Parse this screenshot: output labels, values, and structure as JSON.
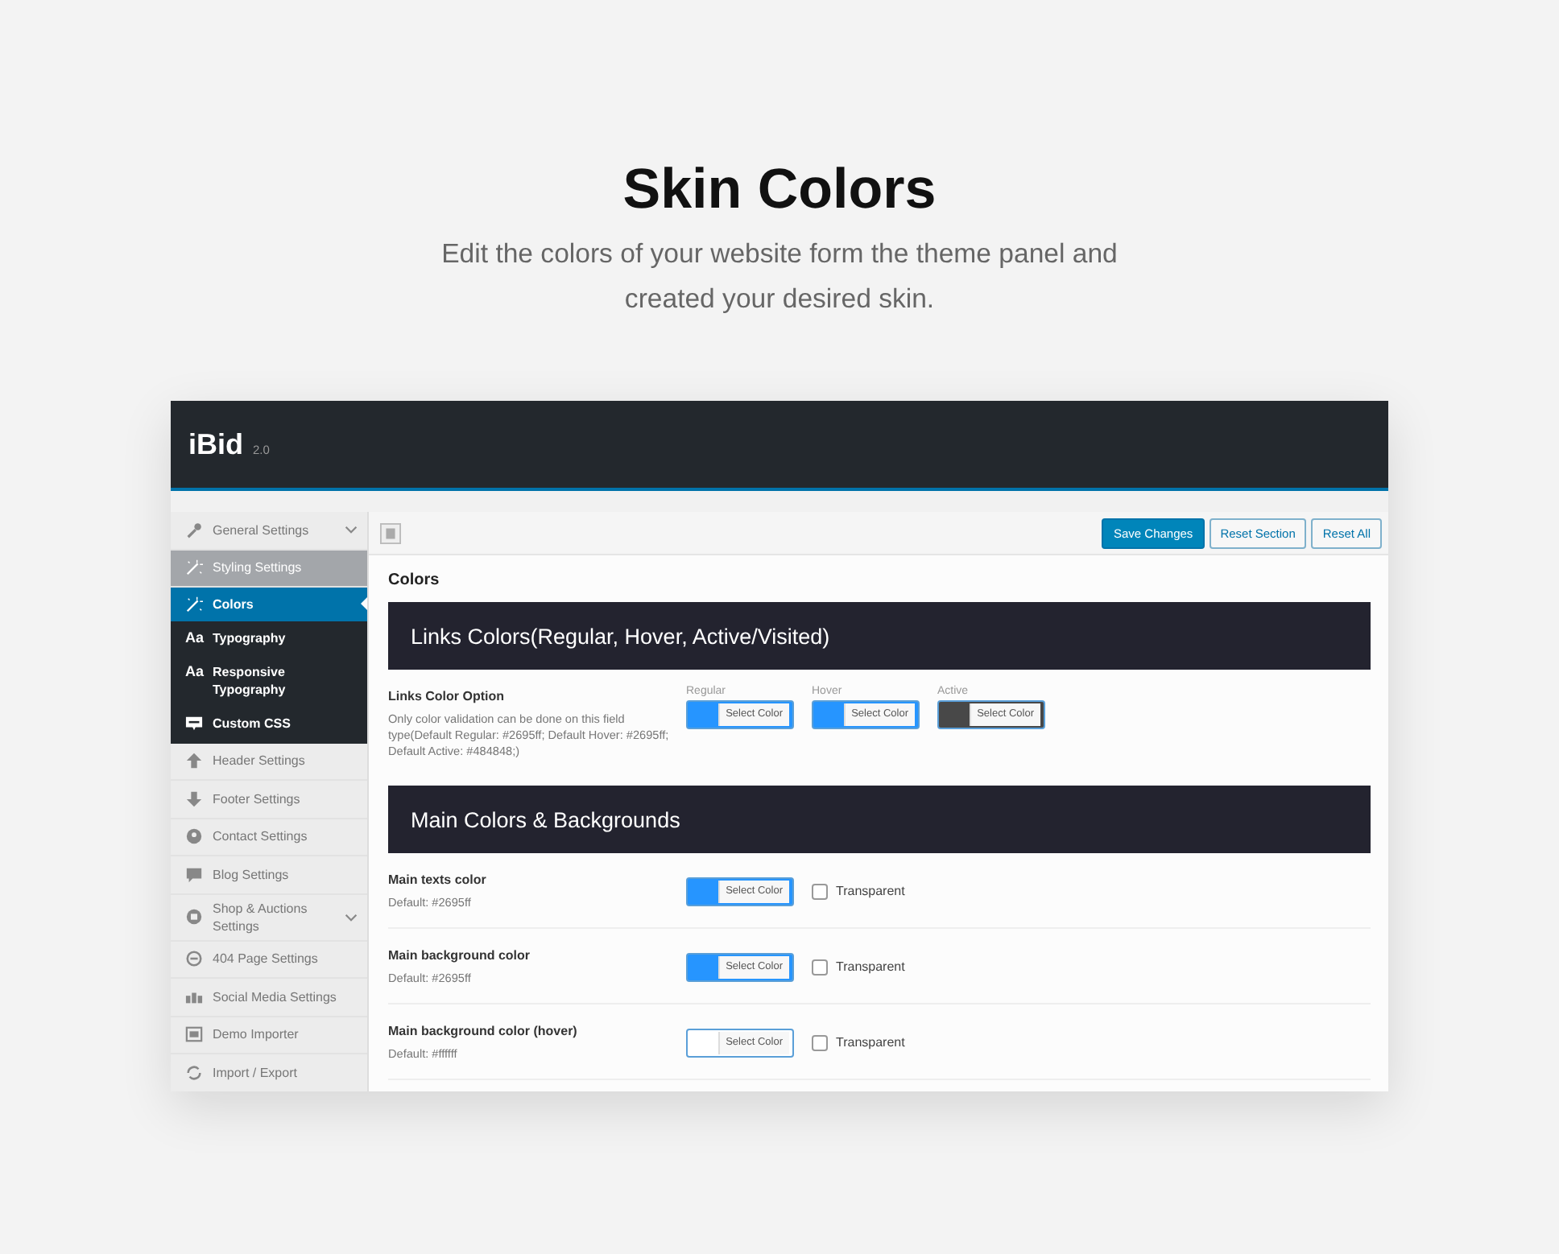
{
  "hero": {
    "title": "Skin Colors",
    "subtitle": "Edit the colors of your website form the theme panel and created your desired skin."
  },
  "panel": {
    "logo": "iBid",
    "version": "2.0"
  },
  "sidebar": {
    "items": [
      {
        "label": "General Settings",
        "has_submenu": true,
        "highlighted": false
      },
      {
        "label": "Styling Settings",
        "has_submenu": false,
        "highlighted": true,
        "children": [
          {
            "label": "Colors",
            "selected": true
          },
          {
            "label": "Typography",
            "selected": false,
            "glyph": "Aa"
          },
          {
            "label": "Responsive Typography",
            "selected": false,
            "glyph": "Aa"
          },
          {
            "label": "Custom CSS",
            "selected": false
          }
        ]
      },
      {
        "label": "Header Settings",
        "has_submenu": false,
        "highlighted": false
      },
      {
        "label": "Footer Settings",
        "has_submenu": false,
        "highlighted": false
      },
      {
        "label": "Contact Settings",
        "has_submenu": false,
        "highlighted": false
      },
      {
        "label": "Blog Settings",
        "has_submenu": false,
        "highlighted": false
      },
      {
        "label": "Shop & Auctions Settings",
        "has_submenu": true,
        "highlighted": false
      },
      {
        "label": "404 Page Settings",
        "has_submenu": false,
        "highlighted": false
      },
      {
        "label": "Social Media Settings",
        "has_submenu": false,
        "highlighted": false
      },
      {
        "label": "Demo Importer",
        "has_submenu": false,
        "highlighted": false
      },
      {
        "label": "Import / Export",
        "has_submenu": false,
        "highlighted": false
      }
    ]
  },
  "toolbar": {
    "buttons": [
      {
        "label": "Save Changes",
        "kind": "primary"
      },
      {
        "label": "Reset Section",
        "kind": "secondary"
      },
      {
        "label": "Reset All",
        "kind": "secondary"
      }
    ]
  },
  "content": {
    "title": "Colors",
    "sections": [
      {
        "heading": "Links Colors(Regular, Hover, Active/Visited)",
        "fields": [
          {
            "kind": "multi",
            "title": "Links Color Option",
            "description": "Only color validation can be done on this field type(Default Regular: #2695ff; Default Hover: #2695ff; Default Active: #484848;)",
            "pickers": [
              {
                "label": "Regular",
                "button": "Select Color",
                "color": "#2695ff"
              },
              {
                "label": "Hover",
                "button": "Select Color",
                "color": "#2695ff"
              },
              {
                "label": "Active",
                "button": "Select Color",
                "color": "#484848"
              }
            ]
          }
        ]
      },
      {
        "heading": "Main Colors & Backgrounds",
        "fields": [
          {
            "kind": "single",
            "title": "Main texts color",
            "description": "Default: #2695ff",
            "pickers": [
              {
                "button": "Select Color",
                "color": "#2695ff"
              }
            ],
            "checkbox": {
              "label": "Transparent",
              "checked": false
            }
          },
          {
            "kind": "single",
            "title": "Main background color",
            "description": "Default: #2695ff",
            "pickers": [
              {
                "button": "Select Color",
                "color": "#2695ff"
              }
            ],
            "checkbox": {
              "label": "Transparent",
              "checked": false
            }
          },
          {
            "kind": "single",
            "title": "Main background color (hover)",
            "description": "Default: #ffffff",
            "pickers": [
              {
                "button": "Select Color",
                "color": "#ffffff"
              }
            ],
            "checkbox": {
              "label": "Transparent",
              "checked": false
            }
          }
        ]
      }
    ]
  }
}
